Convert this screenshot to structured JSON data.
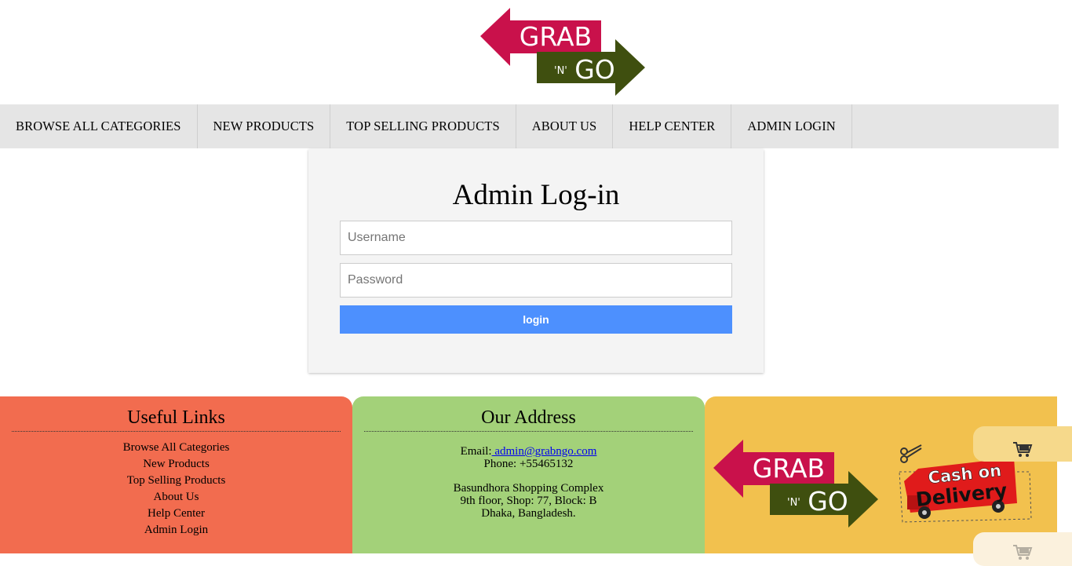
{
  "brand": {
    "logo_line1": "GRAB",
    "logo_line2_small": "'N'",
    "logo_line2": "GO",
    "colors": {
      "primary": "#c9114b",
      "secondary": "#3f4f0f"
    }
  },
  "nav": {
    "items": [
      {
        "label": "BROWSE ALL CATEGORIES"
      },
      {
        "label": "NEW PRODUCTS"
      },
      {
        "label": "TOP SELLING PRODUCTS"
      },
      {
        "label": "ABOUT US"
      },
      {
        "label": "HELP CENTER"
      },
      {
        "label": "ADMIN LOGIN"
      }
    ]
  },
  "login": {
    "title": "Admin Log-in",
    "username_placeholder": "Username",
    "password_placeholder": "Password",
    "button_label": "login",
    "button_color": "#4d90fe"
  },
  "footer": {
    "links": {
      "title": "Useful Links",
      "items": [
        {
          "label": "Browse All Categories"
        },
        {
          "label": "New Products"
        },
        {
          "label": "Top Selling Products"
        },
        {
          "label": "About Us"
        },
        {
          "label": "Help Center"
        },
        {
          "label": "Admin Login"
        }
      ],
      "color": "#f26c4f"
    },
    "address": {
      "title": "Our Address",
      "email_label": "Email:",
      "email": " admin@grabngo.com",
      "phone": "Phone: +55465132",
      "line1": "Basundhora Shopping Complex",
      "line2": "9th floor, Shop: 77, Block: B",
      "line3": "Dhaka, Bangladesh.",
      "color": "#a3d179"
    },
    "promo": {
      "badge_line1": "Cash on",
      "badge_line2": "Delivery",
      "color": "#f2c14e"
    }
  },
  "icons": {
    "cart": "shopping-cart-icon",
    "scissors": "scissors-icon",
    "truck": "truck-icon"
  }
}
